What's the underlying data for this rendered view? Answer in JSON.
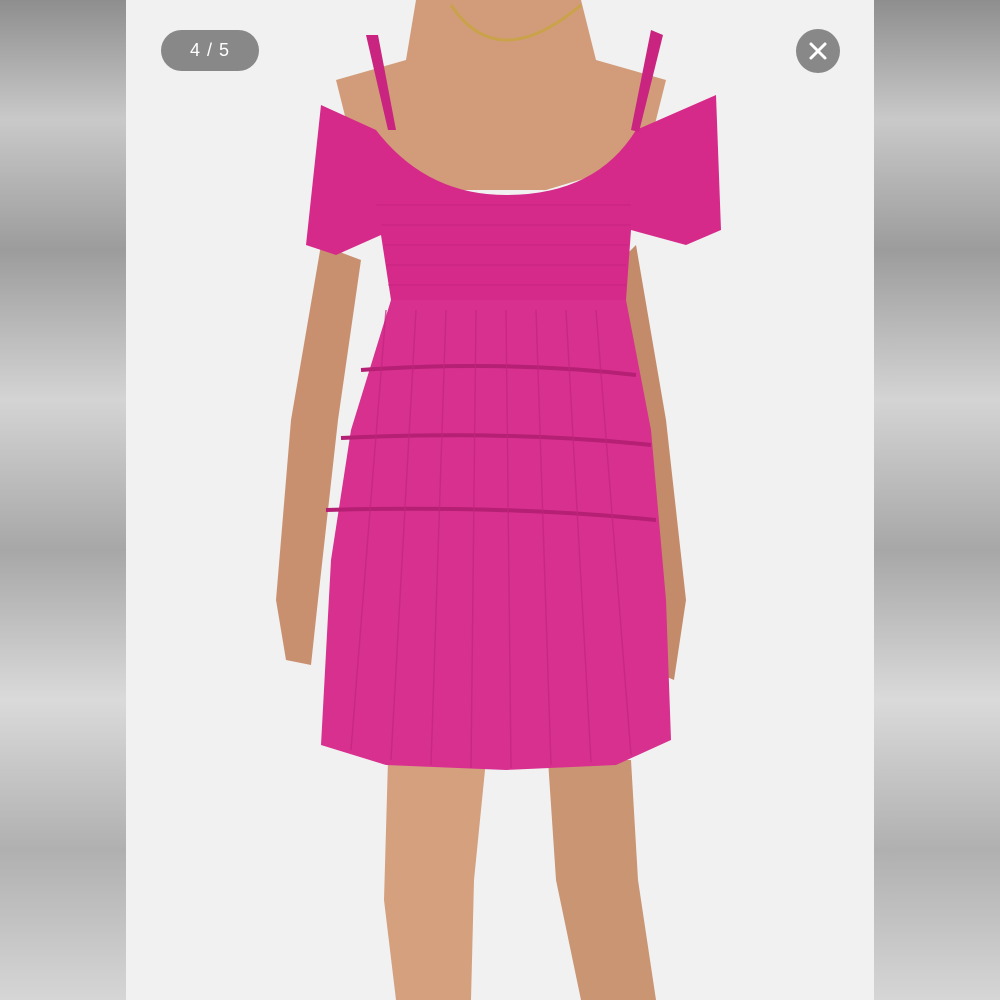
{
  "viewer": {
    "counter_text": "4 / 5",
    "current_image": 4,
    "total_images": 5
  },
  "controls": {
    "close_icon": "close-icon"
  },
  "photo": {
    "subject": "product-photo-pink-dress",
    "dress_color": "#d62a8a",
    "background_color": "#f1f1f1"
  }
}
